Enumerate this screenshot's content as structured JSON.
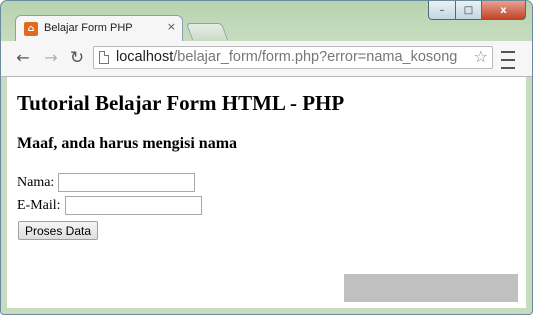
{
  "browser": {
    "tab_title": "Belajar Form PHP",
    "tab_close": "×",
    "url_host": "localhost",
    "url_rest": "/belajar_form/form.php?error=nama_kosong",
    "window_controls": {
      "minimize": "–",
      "maximize": "□",
      "close": "x"
    }
  },
  "page": {
    "heading": "Tutorial Belajar Form HTML - PHP",
    "error_message": "Maaf, anda harus mengisi nama",
    "form": {
      "nama_label": "Nama:",
      "nama_value": "",
      "email_label": "E-Mail:",
      "email_value": "",
      "submit_label": "Proses Data"
    }
  },
  "icons": {
    "back": "arrow-left-icon",
    "forward": "arrow-right-icon",
    "reload": "reload-icon",
    "bookmark": "star-icon",
    "menu": "hamburger-menu-icon",
    "favicon": "xampp-icon"
  },
  "colors": {
    "window_frame": "#c7dcbf",
    "favicon": "#e06b1f",
    "close_button": "#c2442a"
  }
}
